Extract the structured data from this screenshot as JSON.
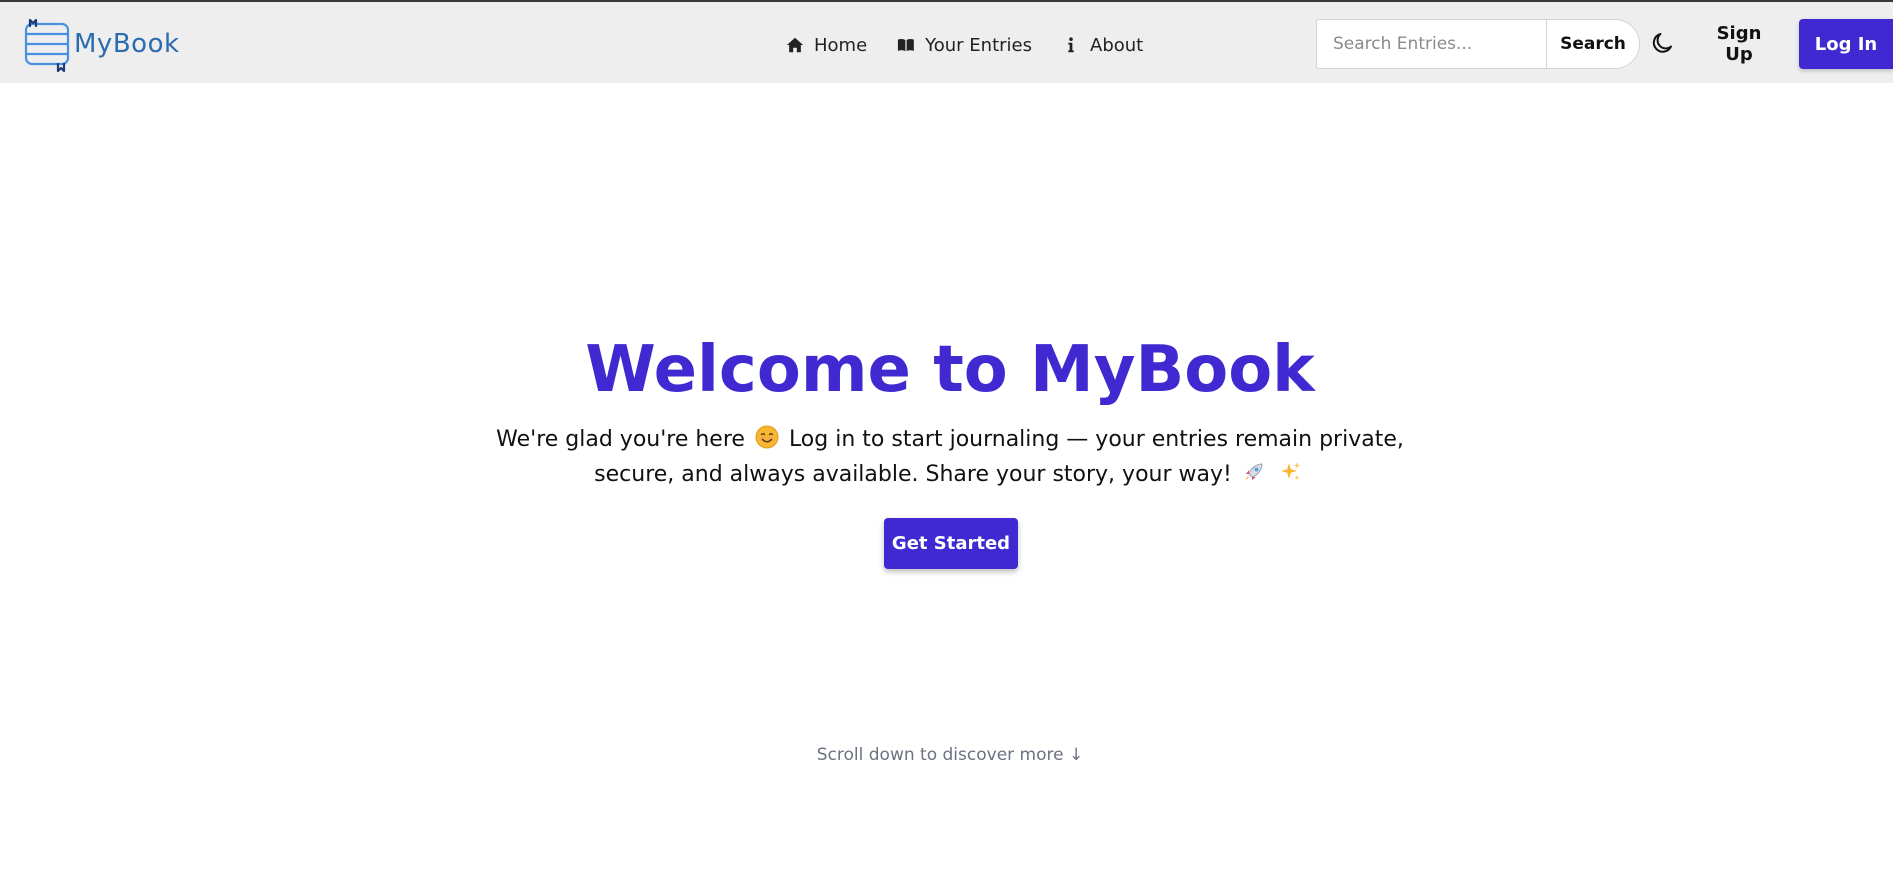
{
  "brand": {
    "name": "MyBook",
    "color": "#2b6cb0"
  },
  "nav": {
    "items": [
      {
        "label": "Home",
        "icon": "home-icon"
      },
      {
        "label": "Your Entries",
        "icon": "book-icon"
      },
      {
        "label": "About",
        "icon": "info-icon"
      }
    ]
  },
  "search": {
    "placeholder": "Search Entries...",
    "value": "",
    "button_label": "Search"
  },
  "theme_toggle": {
    "icon": "moon-icon"
  },
  "auth": {
    "signup_label": "Sign Up",
    "login_label": "Log In"
  },
  "hero": {
    "title": "Welcome to MyBook",
    "subtitle_part1": "We're glad you're here",
    "subtitle_part2": "Log in to start journaling — your entries remain private, secure, and always available. Share your story, your way!",
    "cta_label": "Get Started"
  },
  "scroll_hint": "Scroll down to discover more ↓",
  "colors": {
    "accent": "#4129d1",
    "navbar_bg": "#eeeeee",
    "muted_text": "#6b7280"
  }
}
